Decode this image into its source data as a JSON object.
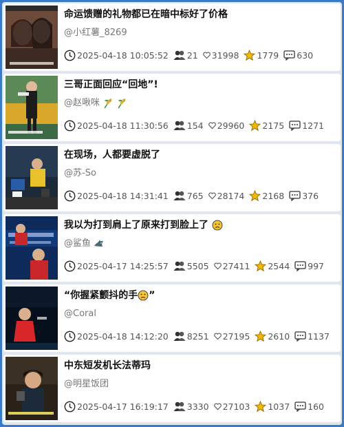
{
  "feed": {
    "items": [
      {
        "title": "命运馈赠的礼物都已在暗中标好了价格",
        "title_suffix": "",
        "author": "@小红薯_8269",
        "author_suffix": "",
        "datetime": "2025-04-18 10:05:52",
        "comments_count": "21",
        "likes": "31998",
        "favorites": "1779",
        "shares": "630"
      },
      {
        "title": "三哥正面回应“回地”!",
        "title_suffix": "",
        "author": "@赵啾咪",
        "author_suffix": "",
        "datetime": "2025-04-18 11:30:56",
        "comments_count": "154",
        "likes": "29960",
        "favorites": "2175",
        "shares": "1271"
      },
      {
        "title": "在现场，人都要虚脱了",
        "title_suffix": "",
        "author": "@苏-So",
        "author_suffix": "",
        "datetime": "2025-04-18 14:31:41",
        "comments_count": "765",
        "likes": "28174",
        "favorites": "2168",
        "shares": "376"
      },
      {
        "title": "我以为打到肩上了原来打到脸上了",
        "title_suffix": "",
        "author": "@鲨鱼",
        "author_suffix": "",
        "datetime": "2025-04-17 14:25:57",
        "comments_count": "5505",
        "likes": "27411",
        "favorites": "2544",
        "shares": "997"
      },
      {
        "title": "“你握紧颤抖的手",
        "title_suffix": "”",
        "author": "@Coral",
        "author_suffix": "",
        "datetime": "2025-04-18 14:12:20",
        "comments_count": "8251",
        "likes": "27195",
        "favorites": "2610",
        "shares": "1137"
      },
      {
        "title": "中东短发机长法蒂玛",
        "title_suffix": "",
        "author": "@明星饭团",
        "author_suffix": "",
        "datetime": "2025-04-17 16:19:17",
        "comments_count": "3330",
        "likes": "27103",
        "favorites": "1037",
        "shares": "160"
      }
    ]
  },
  "icons": {
    "time": "clock-icon",
    "comments": "people-icon",
    "likes": "heart-icon",
    "favorites": "star-icon",
    "shares": "message-icon"
  },
  "colors": {
    "background": "#3a7bc8",
    "star": "#f5b800",
    "text_muted": "#777777"
  }
}
